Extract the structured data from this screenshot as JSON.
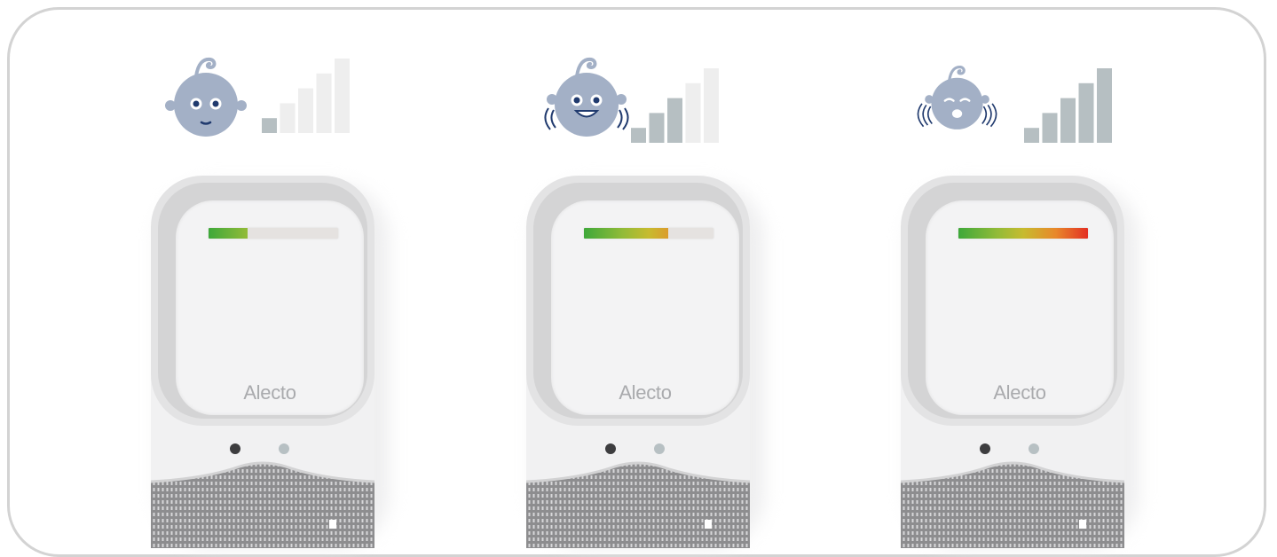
{
  "brand": "Alecto",
  "colors": {
    "baby": "#a3b0c6",
    "baby_accent": "#203a6e",
    "signal_active": "#b6bfc2",
    "signal_inactive": "#eeeeee",
    "level_low": "#3ea83a",
    "level_high": "#e32f23"
  },
  "panels": [
    {
      "state": "calm",
      "signal_level": 1,
      "signal_bars": 5,
      "sound_level": 0.3
    },
    {
      "state": "babbling",
      "signal_level": 3,
      "signal_bars": 5,
      "sound_level": 0.65
    },
    {
      "state": "crying",
      "signal_level": 5,
      "signal_bars": 5,
      "sound_level": 1.0
    }
  ]
}
